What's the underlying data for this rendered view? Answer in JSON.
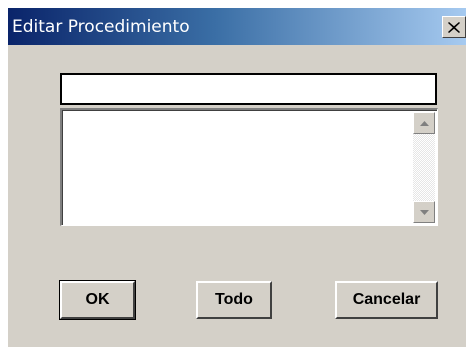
{
  "dialog": {
    "title": "Editar Procedimiento",
    "close_icon": "close-icon"
  },
  "form": {
    "name_value": "",
    "list_value": ""
  },
  "scrollbar": {
    "up_icon": "scroll-up-arrow-icon",
    "down_icon": "scroll-down-arrow-icon"
  },
  "buttons": {
    "ok_label": "OK",
    "todo_label": "Todo",
    "cancel_label": "Cancelar"
  },
  "colors": {
    "dialog_background": "#d4d0c8",
    "titlebar_start": "#0a246a",
    "titlebar_end": "#a6caf0",
    "title_text": "#ffffff"
  }
}
